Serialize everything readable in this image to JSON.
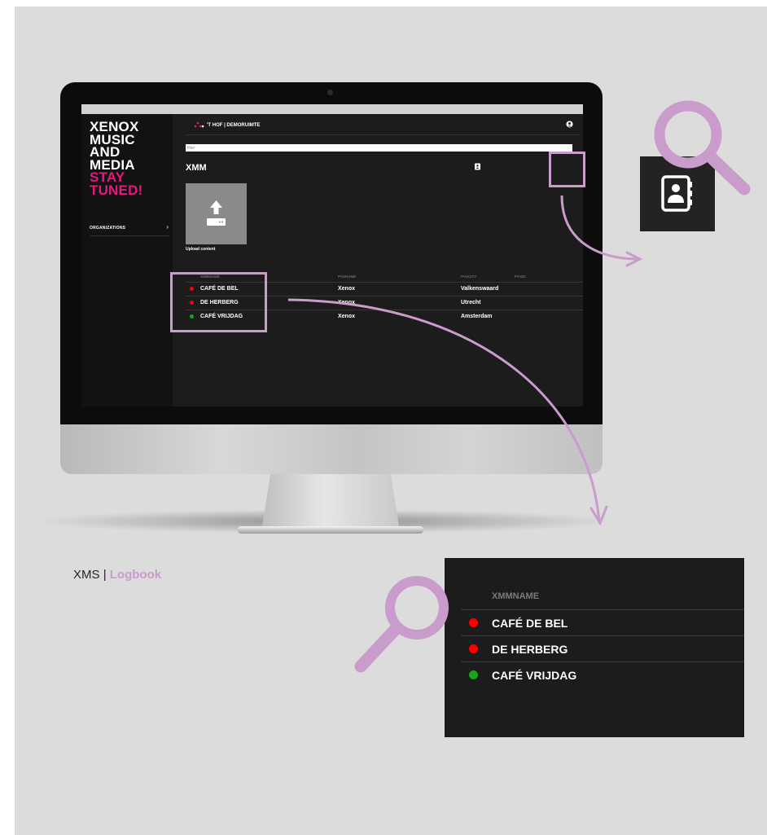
{
  "colors": {
    "accent_pink": "#e5197e",
    "highlight_lavender": "#c99ccc",
    "status_red": "#ff0000",
    "status_green": "#1aa41a"
  },
  "sidebar": {
    "logo_lines": [
      "XENOX",
      "MUSIC",
      "AND",
      "MEDIA"
    ],
    "logo_tagline": [
      "STAY",
      "TUNED!"
    ],
    "nav_item": "ORGANIZATIONS",
    "nav_chevron_icon": "chevron-right-icon"
  },
  "header": {
    "location": "'T HOF | DEMORUIMTE",
    "user_icon": "user-circle-icon"
  },
  "filter": {
    "placeholder": "filter"
  },
  "main": {
    "title": "XMM",
    "contact_icon": "contacts-book-icon",
    "upload_label": "Upload content",
    "upload_icon": "upload-icon"
  },
  "table": {
    "columns": [
      "XMMNAME",
      "PVXNAME",
      "PVXCITY",
      "PVXID"
    ],
    "rows": [
      {
        "status": "red",
        "xmmname": "CAFÉ DE BEL",
        "pvxname": "Xenox",
        "pvxcity": "Valkenswaard",
        "pvxid": ""
      },
      {
        "status": "red",
        "xmmname": "DE HERBERG",
        "pvxname": "Xenox",
        "pvxcity": "Utrecht",
        "pvxid": ""
      },
      {
        "status": "green",
        "xmmname": "CAFÉ VRIJDAG",
        "pvxname": "Xenox",
        "pvxcity": "Amsterdam",
        "pvxid": ""
      }
    ]
  },
  "caption": {
    "product": "XMS",
    "separator": "|",
    "section": "Logbook"
  },
  "zoom_panel": {
    "header": "XMMNAME",
    "rows": [
      {
        "status": "red",
        "name": "CAFÉ DE BEL"
      },
      {
        "status": "red",
        "name": "DE HERBERG"
      },
      {
        "status": "green",
        "name": "CAFÉ VRIJDAG"
      }
    ]
  },
  "icons": [
    "magnifier-icon",
    "contacts-book-icon",
    "arrow-icon"
  ]
}
